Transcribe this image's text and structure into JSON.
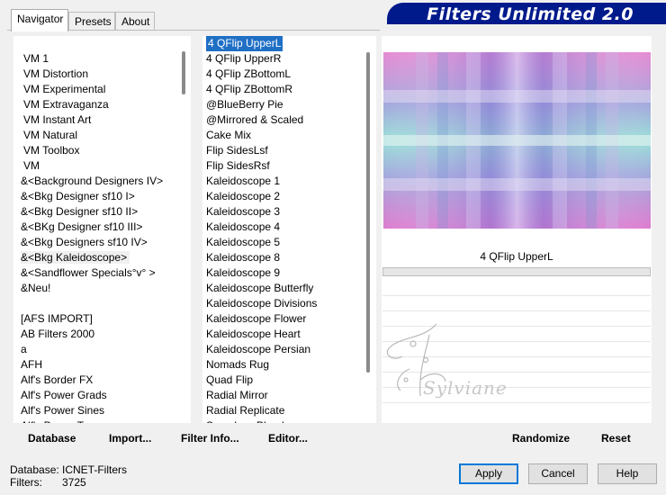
{
  "tabs": [
    "Navigator",
    "Presets",
    "About"
  ],
  "banner": {
    "title": "Filters Unlimited 2.0"
  },
  "categories": [
    "VM 1",
    "VM Distortion",
    "VM Experimental",
    "VM Extravaganza",
    "VM Instant Art",
    "VM Natural",
    "VM Toolbox",
    "VM",
    "&<Background Designers IV>",
    "&<Bkg Designer sf10 I>",
    "&<Bkg Designer sf10 II>",
    "&<BKg Designer sf10 III>",
    "&<Bkg Designers sf10 IV>",
    "&<Bkg Kaleidoscope>",
    "&<Sandflower Specials°v° >",
    "&Neu!",
    "",
    "[AFS IMPORT]",
    "AB Filters 2000",
    "a",
    "AFH",
    "Alf's Border FX",
    "Alf's Power Grads",
    "Alf's Power Sines",
    "Alf's Power Toys"
  ],
  "selected_category": "&<Bkg Kaleidoscope>",
  "filters": [
    "4 QFlip UpperL",
    "4 QFlip UpperR",
    "4 QFlip ZBottomL",
    "4 QFlip ZBottomR",
    "@BlueBerry Pie",
    "@Mirrored & Scaled",
    "Cake Mix",
    "Flip SidesLsf",
    "Flip SidesRsf",
    "Kaleidoscope 1",
    "Kaleidoscope 2",
    "Kaleidoscope 3",
    "Kaleidoscope 4",
    "Kaleidoscope 5",
    "Kaleidoscope 8",
    "Kaleidoscope 9",
    "Kaleidoscope Butterfly",
    "Kaleidoscope Divisions",
    "Kaleidoscope Flower",
    "Kaleidoscope Heart",
    "Kaleidoscope Persian",
    "Nomads Rug",
    "Quad Flip",
    "Radial Mirror",
    "Radial Replicate",
    "Seamless Blend"
  ],
  "selected_filter": "4 QFlip UpperL",
  "preview": {
    "filter_name": "4 QFlip UpperL",
    "watermark": "Sylviane"
  },
  "buttons": {
    "database": "Database",
    "import": "Import...",
    "filter_info": "Filter Info...",
    "editor": "Editor...",
    "randomize": "Randomize",
    "reset": "Reset",
    "apply": "Apply",
    "cancel": "Cancel",
    "help": "Help"
  },
  "status": {
    "database_label": "Database:",
    "database_value": "ICNET-Filters",
    "filters_label": "Filters:",
    "filters_value": "3725"
  },
  "colors": {
    "banner_bg": "#001a8c",
    "selection": "#1f6fc5",
    "accent_pink": "#d46fc0",
    "accent_teal": "#8fd8d6"
  }
}
